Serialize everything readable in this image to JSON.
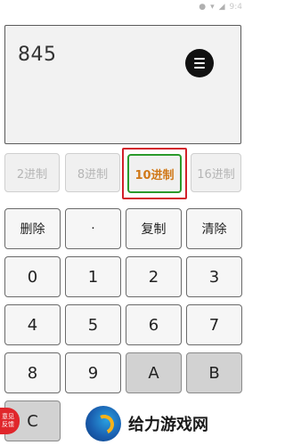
{
  "status": {
    "time": "9:4"
  },
  "display": {
    "value": "845"
  },
  "bases": [
    {
      "label": "2进制",
      "selected": false
    },
    {
      "label": "8进制",
      "selected": false
    },
    {
      "label": "10进制",
      "selected": true
    },
    {
      "label": "16进制",
      "selected": false
    }
  ],
  "actions": {
    "delete": "删除",
    "dot": "·",
    "copy": "复制",
    "clear": "清除"
  },
  "keys": {
    "k0": "0",
    "k1": "1",
    "k2": "2",
    "k3": "3",
    "k4": "4",
    "k5": "5",
    "k6": "6",
    "k7": "7",
    "k8": "8",
    "k9": "9",
    "kA": "A",
    "kB": "B",
    "kC": "C"
  },
  "ad": {
    "text": "给力游戏网"
  },
  "feedback": {
    "line1": "意见",
    "line2": "反馈"
  },
  "colors": {
    "selected_border": "#2b9a2b",
    "selected_text": "#d07818",
    "highlight_box": "#d21f2a"
  }
}
